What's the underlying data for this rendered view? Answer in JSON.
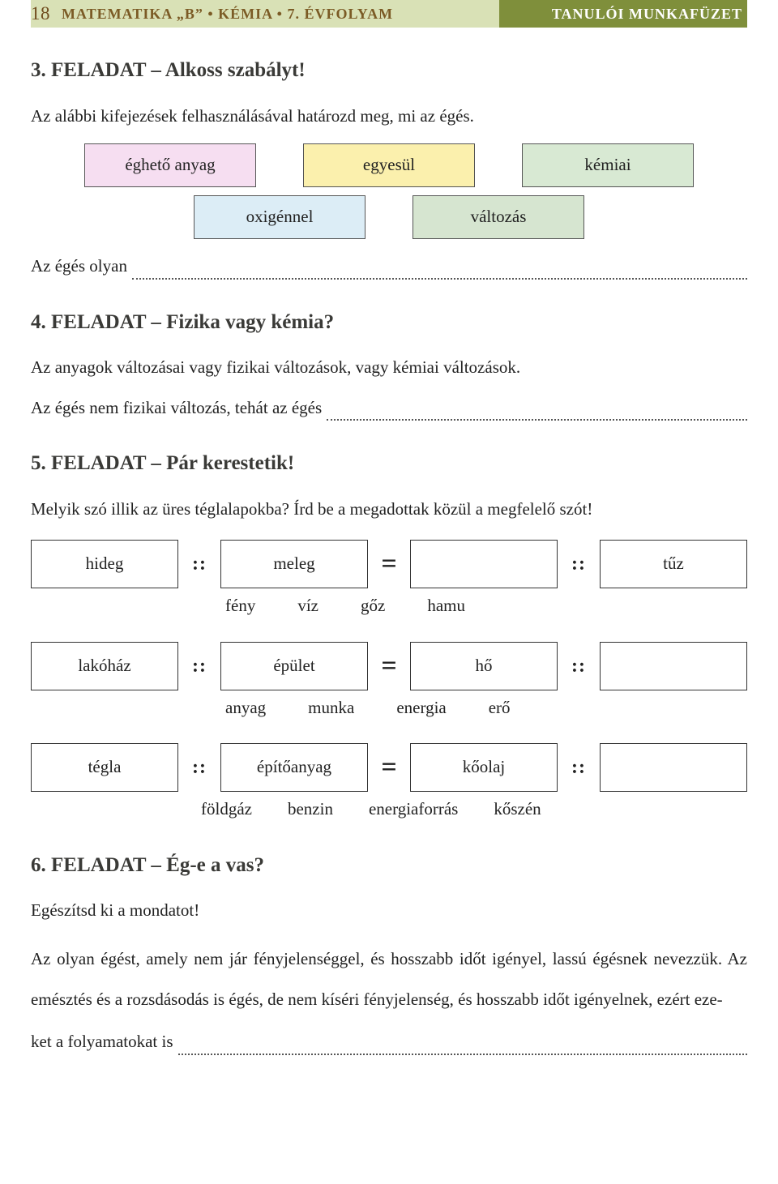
{
  "header": {
    "page_number": "18",
    "breadcrumb": "MATEMATIKA „B” • KÉMIA • 7. ÉVFOLYAM",
    "right": "TANULÓI MUNKAFÜZET"
  },
  "task3": {
    "title": "3. FELADAT – Alkoss szabályt!",
    "intro": "Az alábbi kifejezések felhasználásával határozd meg, mi az égés.",
    "tags_row1": [
      "éghető anyag",
      "egyesül",
      "kémiai"
    ],
    "tags_row2": [
      "oxigénnel",
      "változás"
    ],
    "line_prefix": "Az égés olyan"
  },
  "task4": {
    "title": "4. FELADAT – Fizika vagy kémia?",
    "line1": "Az anyagok változásai vagy fizikai változások, vagy kémiai változások.",
    "line2_prefix": "Az égés nem fizikai változás, tehát az égés"
  },
  "task5": {
    "title": "5. FELADAT – Pár kerestetik!",
    "intro": "Melyik szó illik az üres téglalapokba? Írd be a megadottak közül a megfelelő szót!",
    "rows": [
      {
        "boxes": [
          "hideg",
          "meleg",
          "",
          "tűz"
        ],
        "options": [
          "fény",
          "víz",
          "gőz",
          "hamu"
        ]
      },
      {
        "boxes": [
          "lakóház",
          "épület",
          "hő",
          ""
        ],
        "options": [
          "anyag",
          "munka",
          "energia",
          "erő"
        ]
      },
      {
        "boxes": [
          "tégla",
          "építőanyag",
          "kőolaj",
          ""
        ],
        "options": [
          "földgáz",
          "benzin",
          "energiaforrás",
          "kőszén"
        ]
      }
    ],
    "sep_colon": "::",
    "sep_equals": "="
  },
  "task6": {
    "title": "6. FELADAT – Ég-e a vas?",
    "intro": "Egészítsd ki a mondatot!",
    "paragraph_part1": "Az olyan égést, amely nem jár fényjelenséggel, és hosszabb időt igényel, lassú égésnek nevezzük. Az emésztés és a rozsdásodás is égés, de nem kíséri fényjelenség, és hosszabb időt igényelnek, ezért eze-",
    "paragraph_part2_prefix": "ket a folyamatokat is"
  }
}
